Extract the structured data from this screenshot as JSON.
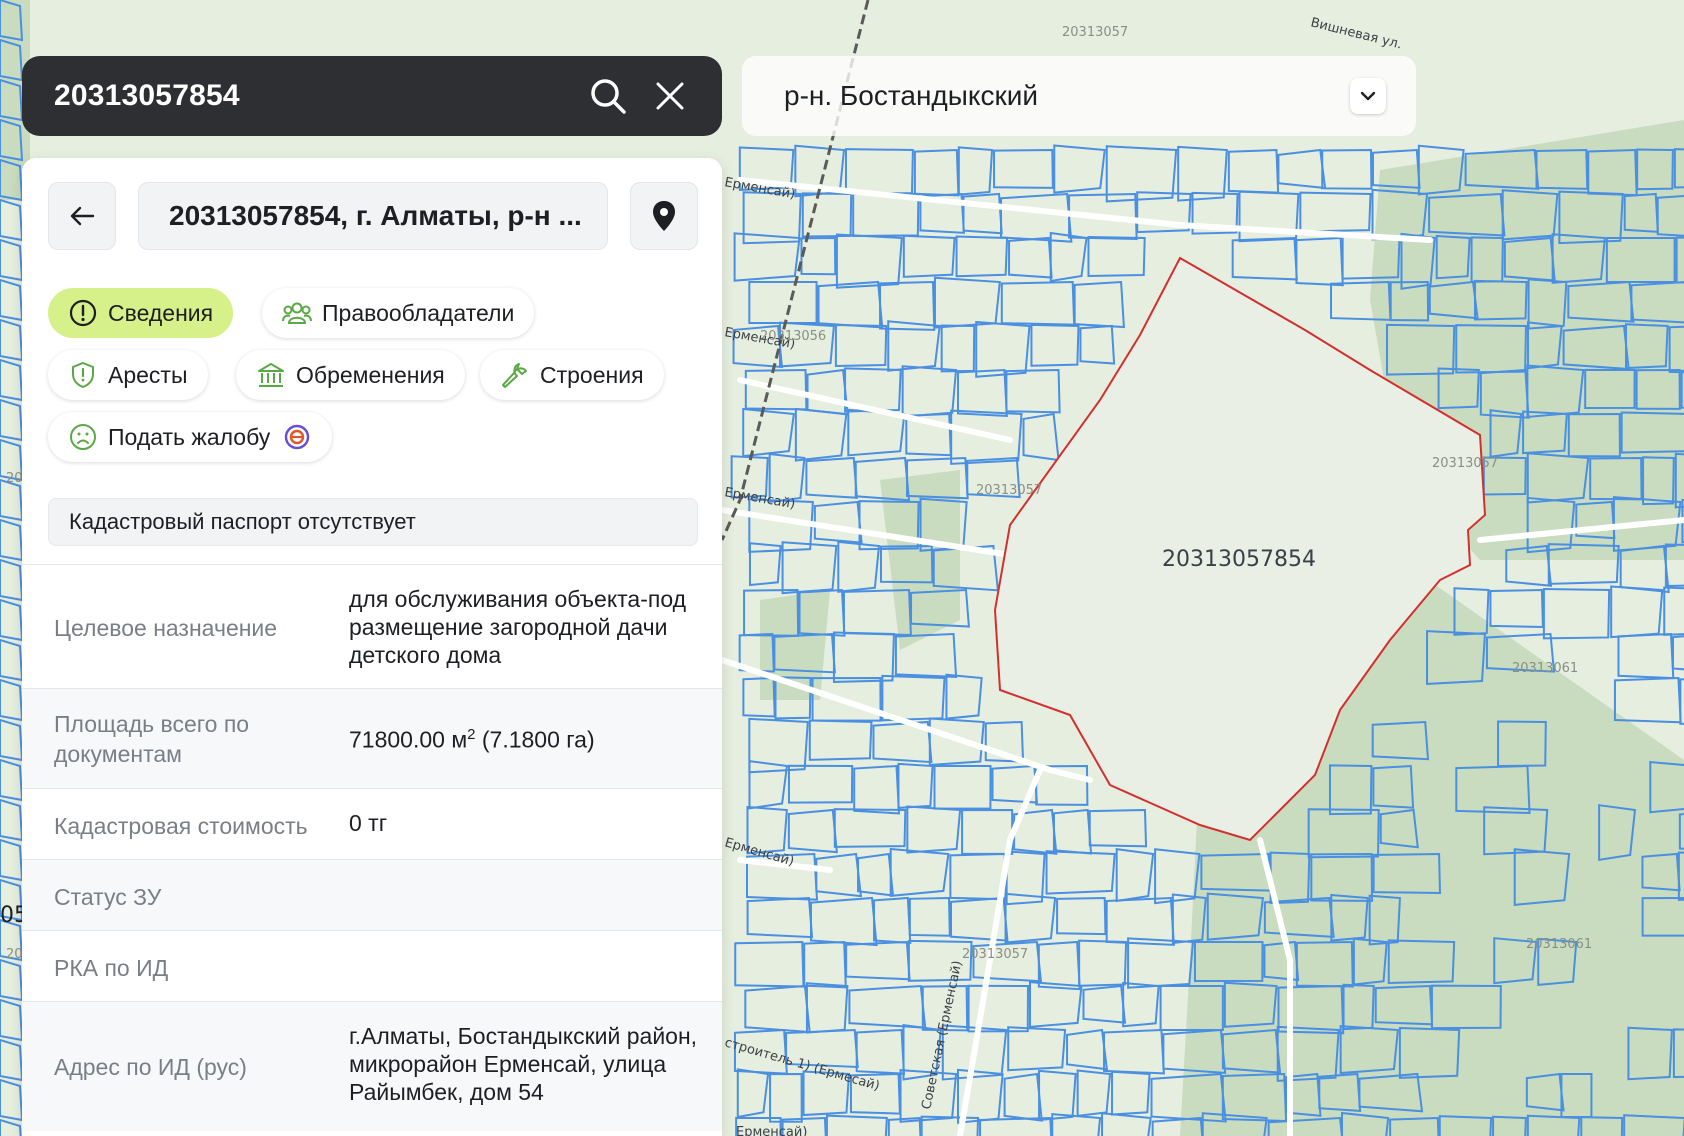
{
  "search": {
    "query": "20313057854",
    "icons": [
      "search-icon",
      "close-icon"
    ]
  },
  "district_select": {
    "value": "р-н. Бостандыкский",
    "icon": "chevron-down-icon"
  },
  "panel": {
    "back_icon": "arrow-left-icon",
    "title": "20313057854, г. Алматы, р-н ...",
    "location_icon": "map-pin-icon",
    "tabs": [
      {
        "label": "Сведения",
        "icon": "info-icon",
        "active": true
      },
      {
        "label": "Правообладатели",
        "icon": "users-icon",
        "active": false
      },
      {
        "label": "Аресты",
        "icon": "shield-icon",
        "active": false
      },
      {
        "label": "Обременения",
        "icon": "bank-icon",
        "active": false
      },
      {
        "label": "Строения",
        "icon": "wrench-icon",
        "active": false
      },
      {
        "label": "Подать жалобу",
        "icon": "sad-face-icon",
        "active": false,
        "badge_icon": "egov-icon"
      }
    ],
    "passport_notice": "Кадастровый паспорт отсутствует",
    "details": [
      {
        "key": "Целевое назначение",
        "value": "для обслуживания объекта-под размещение загородной дачи детского дома"
      },
      {
        "key": "Площадь всего по документам",
        "value_main": "71800.00 м",
        "value_sup": "2",
        "value_tail": " (7.1800 га)"
      },
      {
        "key": "Кадастровая стоимость",
        "value": "0 тг"
      },
      {
        "key": "Статус ЗУ",
        "value": ""
      },
      {
        "key": "РКА по ИД",
        "value": ""
      },
      {
        "key": "Адрес по ИД (рус)",
        "value": "г.Алматы, Бостандыкский район, микрорайон Ерменсай, улица Райымбек, дом 54"
      }
    ]
  },
  "map": {
    "selected_parcel_label": "20313057854",
    "quarter_labels": [
      "20313057",
      "20313056",
      "20313057",
      "20313057",
      "20313061",
      "20313061",
      "20313057"
    ],
    "street_labels": [
      "Вишневая ул.",
      "Ерменсай)",
      "Ерменсай)",
      "Ерменсай)",
      "Ерменсай)",
      "Советская (Ерменсай)",
      "строитель 1) (Ермесай)",
      "Ерменсай)"
    ],
    "edge_labels": [
      "05",
      "20",
      "20"
    ],
    "colors": {
      "parcel_line": "#4a8fe0",
      "selected_outline": "#d32f2f",
      "land": "#e6eedf",
      "green": "#c9dcbf"
    }
  }
}
